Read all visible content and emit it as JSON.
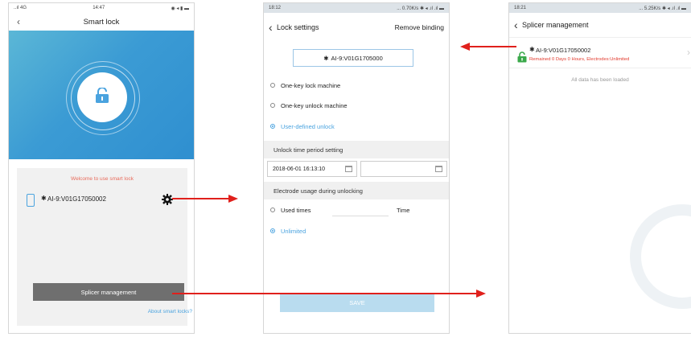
{
  "screen1": {
    "status_left": "..ıl 4G",
    "status_time": "14:47",
    "status_right": "◉ ◂ ▮ ▬",
    "title": "Smart lock",
    "welcome": "Welcome to use smart lock",
    "device_name": "AI-9:V01G17050002",
    "splicer_button": "Splicer management",
    "about_link": "About smart locks?"
  },
  "screen2": {
    "status_left": "18:12",
    "status_right": "... 0.70K/s ✱ ◂ .ıl .ıl ▬",
    "title": "Lock settings",
    "remove_binding": "Remove binding",
    "device_name": "AI-9:V01G1705000",
    "option_one_key_lock": "One-key lock machine",
    "option_one_key_unlock": "One-key unlock machine",
    "option_user_defined": "User-defined unlock",
    "section_unlock_period": "Unlock time period setting",
    "start_time": "2018-06-01 16:13:10",
    "end_time": "",
    "section_electrode": "Electrode usage during unlocking",
    "used_times_label": "Used times",
    "times_unit": "Time",
    "times_value": "",
    "unlimited_label": "Unlimited",
    "save_button": "SAVE"
  },
  "screen3": {
    "status_left": "18:21",
    "status_right": "... 5.25K/s ✱ ◂ .ıl .ıl ▬",
    "title": "Splicer management",
    "device_name": "AI-9:V01G17050002",
    "remaining": "Remained 0 Days 0 Hours,  Electrodes:Unlimited",
    "all_loaded": "All data has been loaded"
  },
  "colors": {
    "accent": "#4aa3df",
    "arrow": "#e0201c",
    "lock_green": "#3aa84a",
    "remaining_red": "#e23b2e"
  }
}
